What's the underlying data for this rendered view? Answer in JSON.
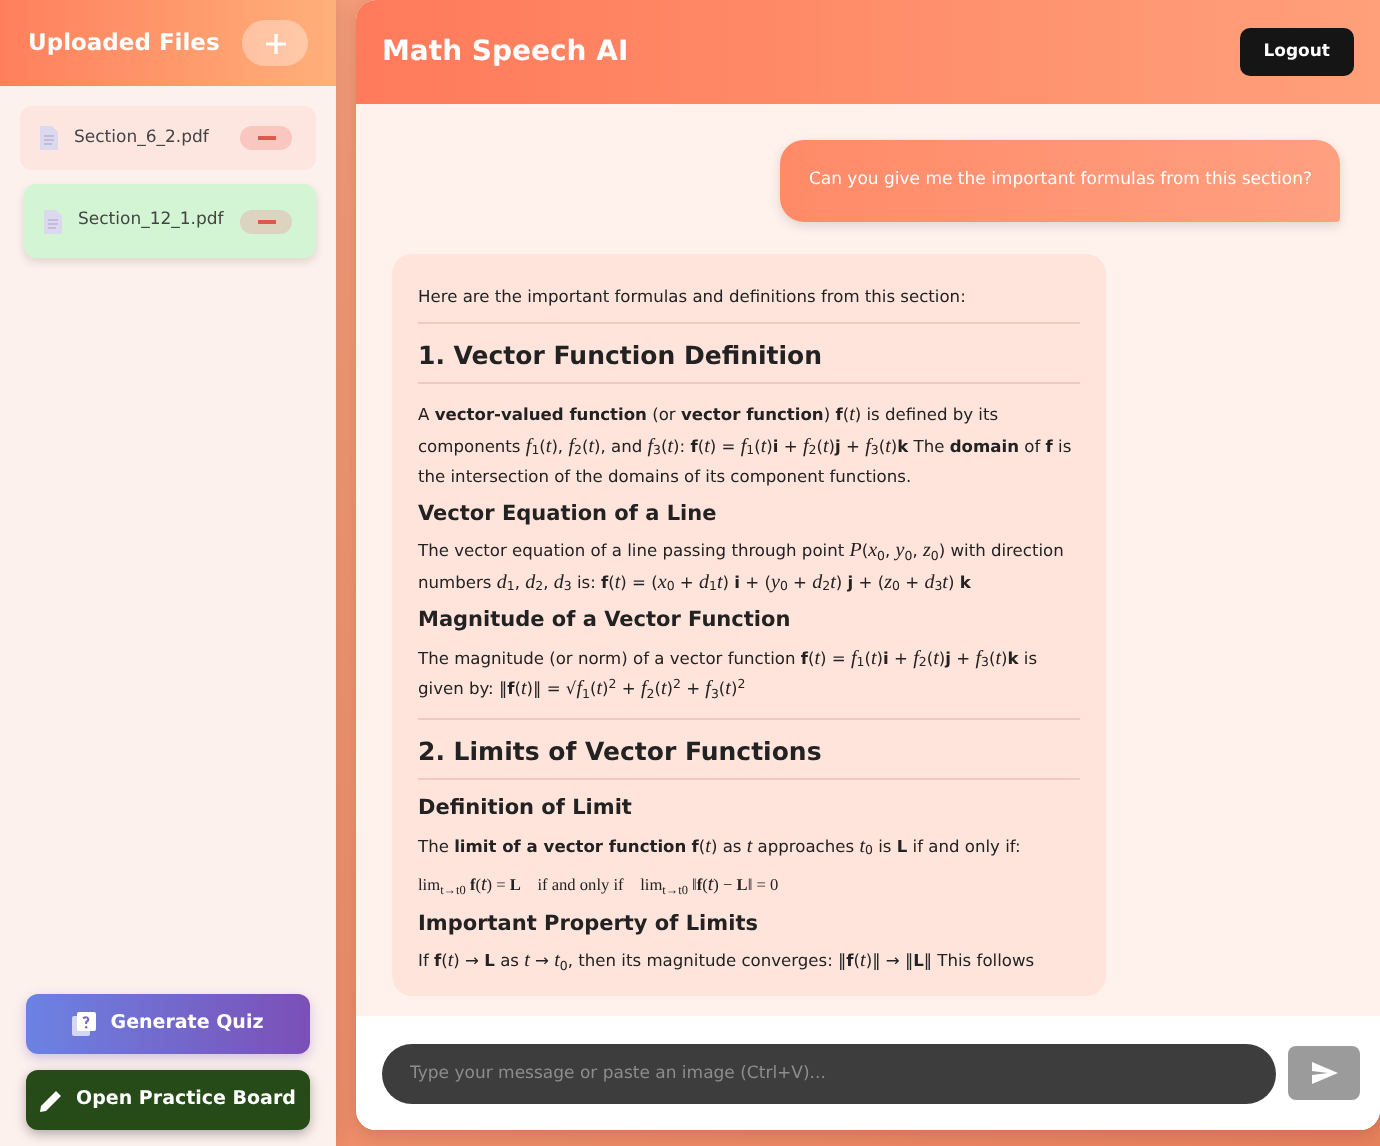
{
  "sidebar": {
    "title": "Uploaded Files",
    "files": [
      {
        "name": "Section_6_2.pdf",
        "selected": false
      },
      {
        "name": "Section_12_1.pdf",
        "selected": true
      }
    ],
    "actions": [
      {
        "kind": "quiz",
        "label": "Generate Quiz"
      },
      {
        "kind": "board",
        "label": "Open Practice Board"
      }
    ]
  },
  "header": {
    "title": "Math Speech AI",
    "logout": "Logout"
  },
  "messages": [
    {
      "kind": "user",
      "text": "Can you give me the important formulas from this section?"
    },
    {
      "kind": "assistant",
      "blocks": [
        {
          "kind": "p",
          "text": "Here are the important formulas and definitions from this section:"
        },
        {
          "kind": "rule"
        },
        {
          "kind": "h2",
          "text": "1. Vector Function Definition"
        },
        {
          "kind": "rule"
        },
        {
          "kind": "p",
          "text": "A **vector-valued function** (or **vector function**) **f**(*t*) is defined by its components *f*$_{1}$(*t*), *f*$_{2}$(*t*), and *f*$_{3}$(*t*): **f**(*t*) = *f*$_{1}$(*t*)**i** + *f*$_{2}$(*t*)**j** + *f*$_{3}$(*t*)**k** The **domain** of **f** is the intersection of the domains of its component functions."
        },
        {
          "kind": "h3",
          "text": "Vector Equation of a Line"
        },
        {
          "kind": "p",
          "text": "The vector equation of a line passing through point *P*(*x*$_{0}$, *y*$_{0}$, *z*$_{0}$) with direction numbers *d*$_{1}$, *d*$_{2}$, *d*$_{3}$ is: **f**(*t*) = (*x*$_{0}$ + *d*$_{1}$*t*) **i** + (*y*$_{0}$ + *d*$_{2}$*t*) **j** + (*z*$_{0}$ + *d*$_{3}$*t*) **k**"
        },
        {
          "kind": "h3",
          "text": "Magnitude of a Vector Function"
        },
        {
          "kind": "p",
          "text": "The magnitude (or norm) of a vector function **f**(*t*) = *f*$_{1}$(*t*)**i** + *f*$_{2}$(*t*)**j** + *f*$_{3}$(*t*)**k** is given by: ‖**f**(*t*)‖ = √*f*$_{1}$(*t*)$^{2}$ + *f*$_{2}$(*t*)$^{2}$ + *f*$_{3}$(*t*)$^{2}$"
        },
        {
          "kind": "rule"
        },
        {
          "kind": "h2",
          "text": "2. Limits of Vector Functions"
        },
        {
          "kind": "rule"
        },
        {
          "kind": "h3",
          "text": "Definition of Limit"
        },
        {
          "kind": "p",
          "text": "The **limit of a vector function** **f**(*t*) as *t* approaches *t*$_{0}$ is **L** if and only if:"
        },
        {
          "kind": "math",
          "text": "lim$_{t→t0}$ **f**(*t*) = **L**    if and only if    lim$_{t→t0}$ ‖**f**(*t*) − **L**‖ = 0"
        },
        {
          "kind": "h3",
          "text": "Important Property of Limits"
        },
        {
          "kind": "p",
          "text": "If **f**(*t*) → **L** as *t* → *t*$_{0}$, then its magnitude converges: ‖**f**(*t*)‖ → ‖**L**‖ This follows"
        }
      ]
    }
  ],
  "composer": {
    "placeholder": "Type your message or paste an image (Ctrl+V)...",
    "send_disabled": true
  }
}
